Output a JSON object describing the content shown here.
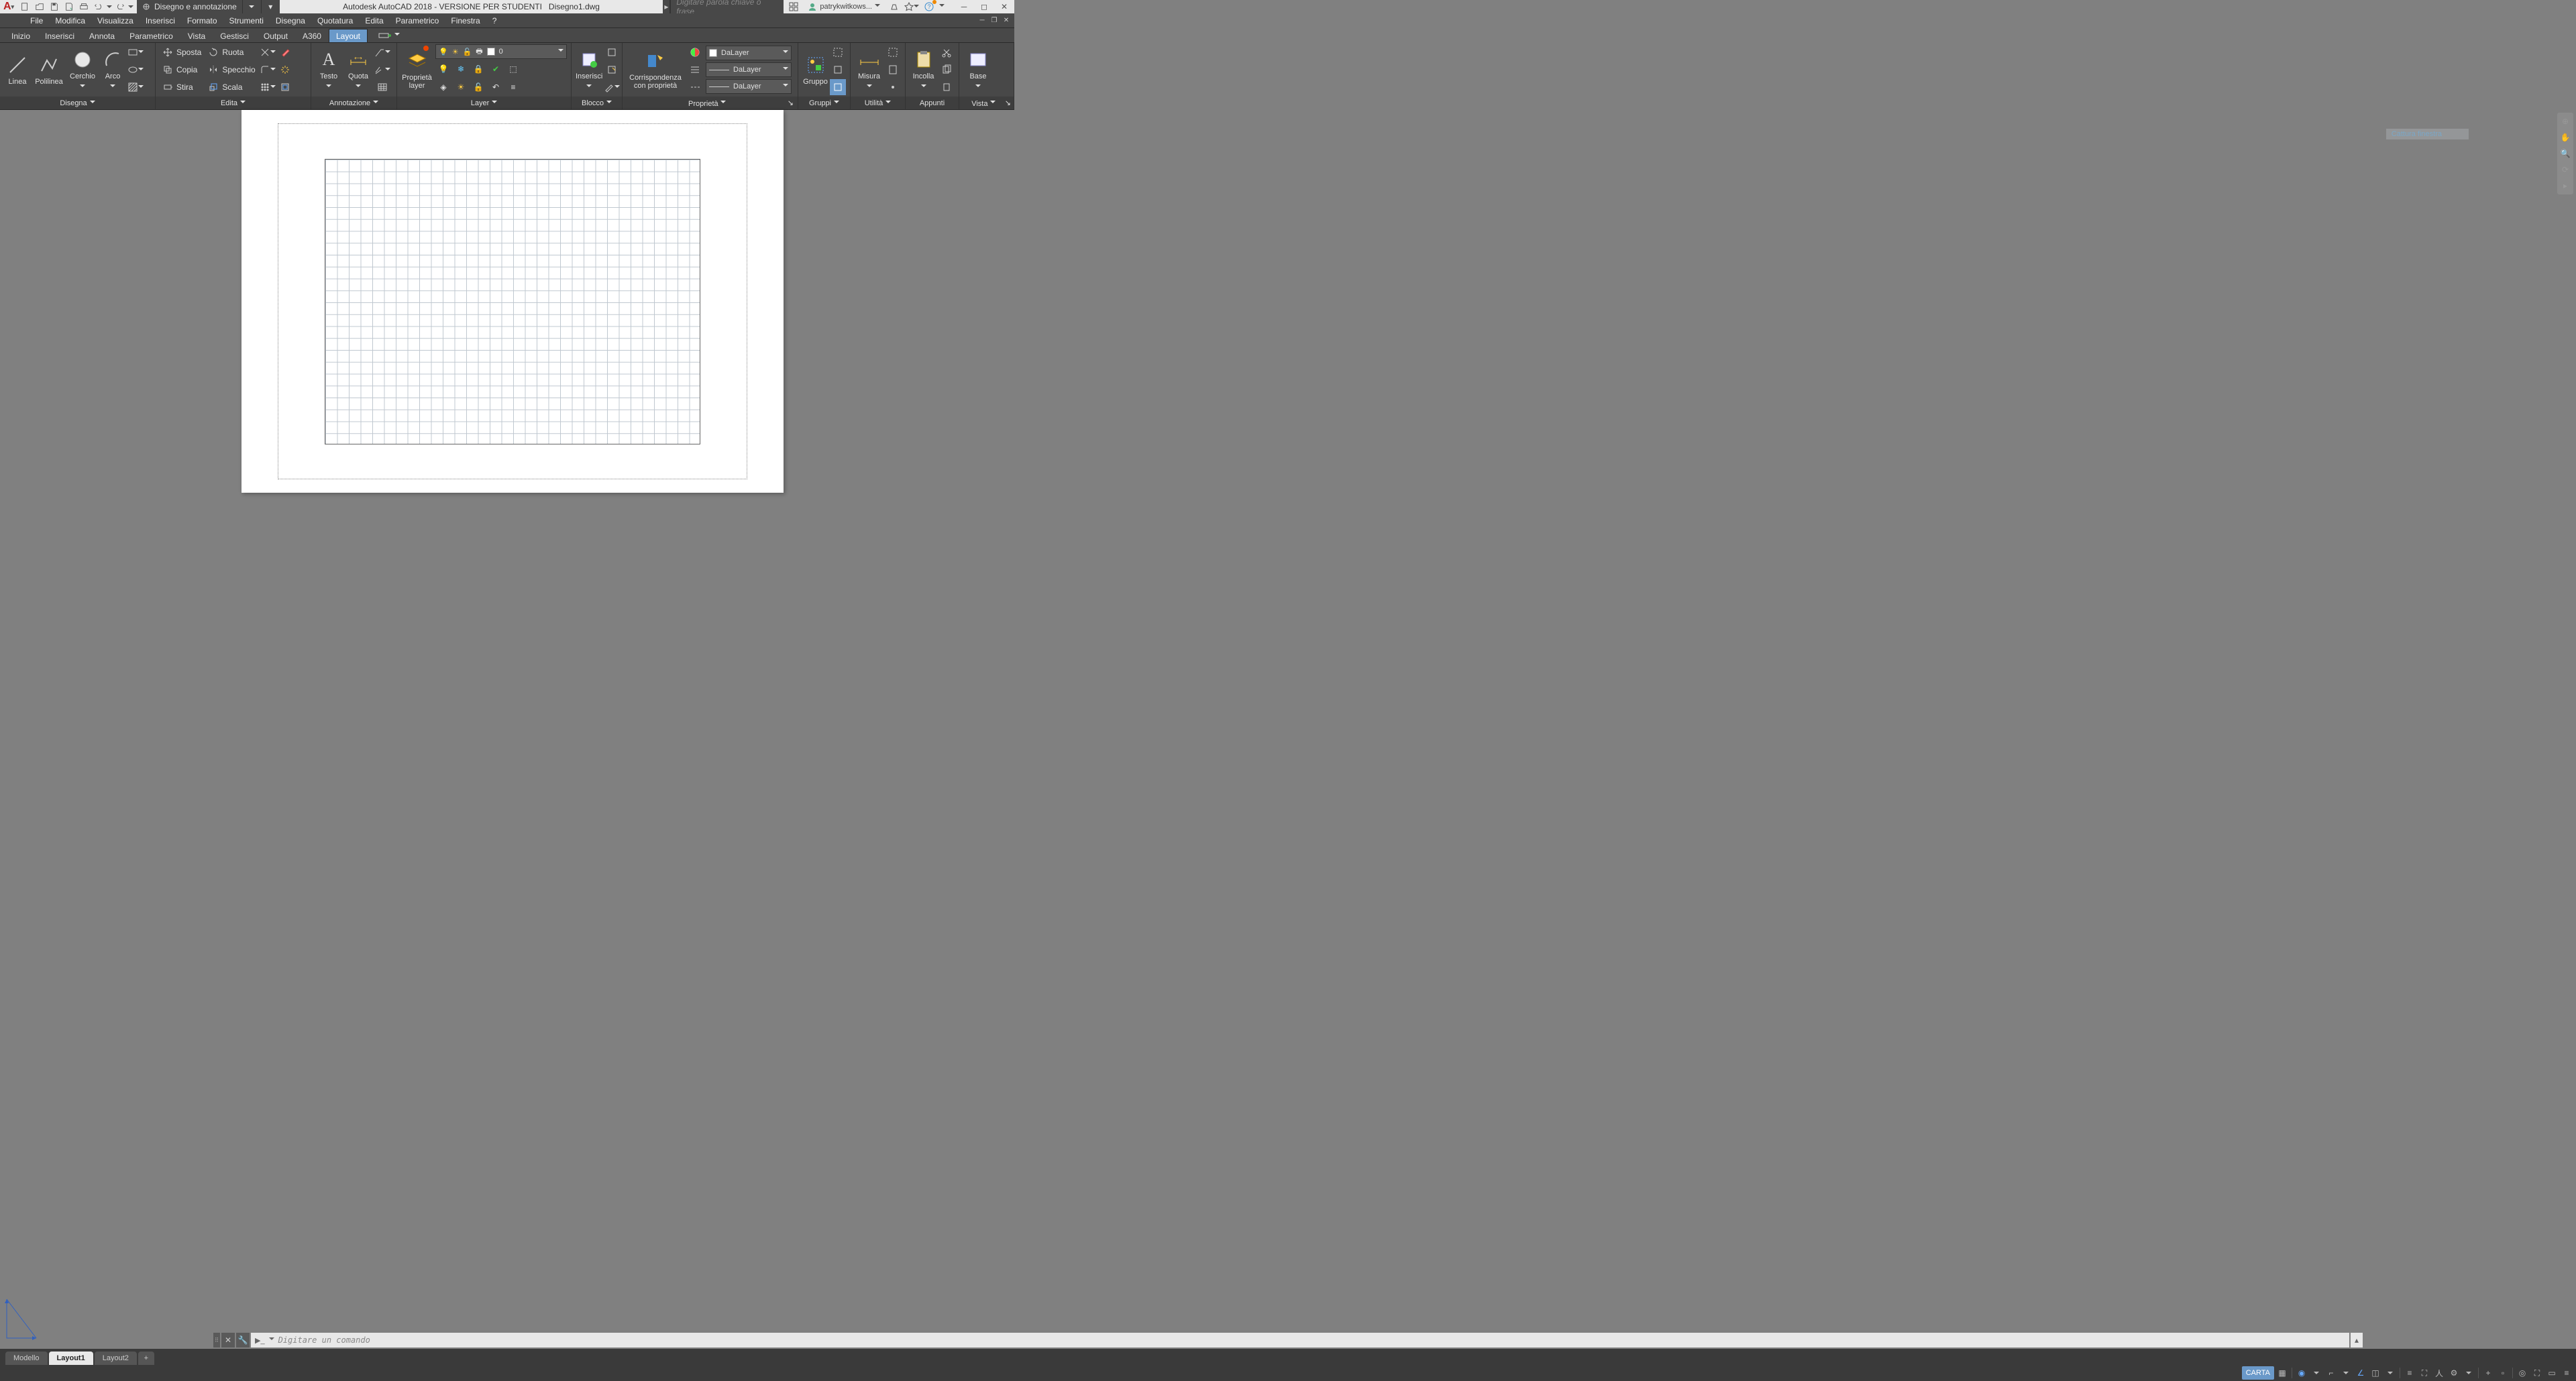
{
  "title": {
    "product": "Autodesk AutoCAD 2018 - VERSIONE PER STUDENTI",
    "file": "Disegno1.dwg"
  },
  "workspace_label": "Disegno e annotazione",
  "search_placeholder": "Digitare parola chiave o frase",
  "user_name": "patrykwitkows...",
  "menus": [
    "File",
    "Modifica",
    "Visualizza",
    "Inserisci",
    "Formato",
    "Strumenti",
    "Disegna",
    "Quotatura",
    "Edita",
    "Parametrico",
    "Finestra",
    "?"
  ],
  "ribbon_tabs": [
    "Inizio",
    "Inserisci",
    "Annota",
    "Parametrico",
    "Vista",
    "Gestisci",
    "Output",
    "A360",
    "Layout"
  ],
  "active_ribbon_tab": "Layout",
  "panels": {
    "disegna": {
      "title": "Disegna",
      "tools": [
        "Linea",
        "Polilinea",
        "Cerchio",
        "Arco"
      ]
    },
    "edita": {
      "title": "Edita",
      "tools": [
        "Sposta",
        "Ruota",
        "Copia",
        "Specchio",
        "Stira",
        "Scala"
      ]
    },
    "annotazione": {
      "title": "Annotazione",
      "tools": [
        "Testo",
        "Quota"
      ]
    },
    "layer": {
      "title": "Layer",
      "big": "Proprietà\nlayer",
      "current": "0"
    },
    "blocco": {
      "title": "Blocco",
      "big": "Inserisci"
    },
    "proprieta": {
      "title": "Proprietà",
      "big": "Corrispondenza\ncon proprietà",
      "bylayer": "DaLayer"
    },
    "gruppi": {
      "title": "Gruppi",
      "big": "Gruppo"
    },
    "utilita": {
      "title": "Utilità",
      "big": "Misura"
    },
    "appunti": {
      "title": "Appunti",
      "big": "Incolla"
    },
    "vista": {
      "title": "Vista",
      "big": "Base"
    }
  },
  "capture_hint": "Cattura finestra",
  "command_placeholder": "Digitare un comando",
  "layout_tabs": {
    "model": "Modello",
    "l1": "Layout1",
    "l2": "Layout2"
  },
  "status": {
    "space": "CARTA"
  }
}
